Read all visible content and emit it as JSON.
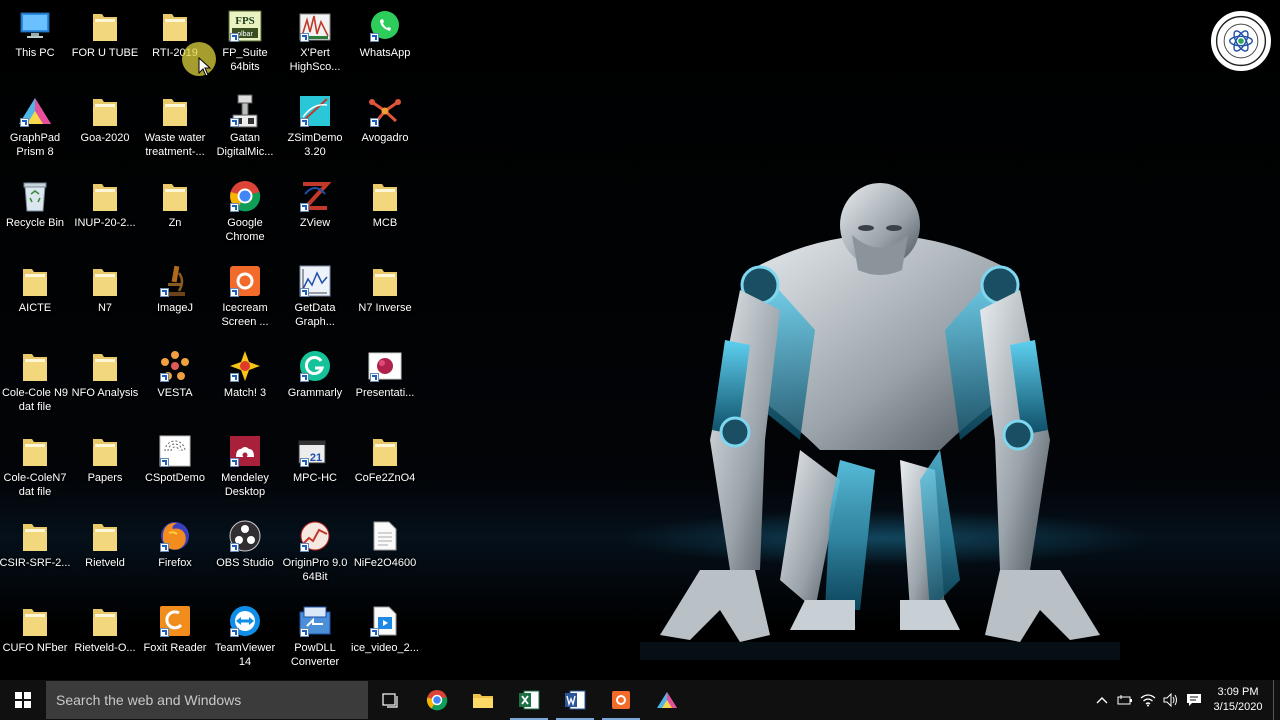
{
  "desktop": {
    "icons": [
      {
        "label": "This PC",
        "icon": "computer-icon"
      },
      {
        "label": "FOR U TUBE",
        "icon": "folder-icon"
      },
      {
        "label": "RTI-2019",
        "icon": "folder-icon"
      },
      {
        "label": "FP_Suite 64bits",
        "icon": "fullprof-icon"
      },
      {
        "label": "X'Pert HighSco...",
        "icon": "xpert-icon"
      },
      {
        "label": "WhatsApp",
        "icon": "whatsapp-icon"
      },
      {
        "label": "GraphPad Prism 8",
        "icon": "prism-icon"
      },
      {
        "label": "Goa-2020",
        "icon": "folder-icon"
      },
      {
        "label": "Waste water treatment-...",
        "icon": "folder-icon"
      },
      {
        "label": "Gatan DigitalMic...",
        "icon": "gatan-icon"
      },
      {
        "label": "ZSimDemo 3.20",
        "icon": "zsim-icon"
      },
      {
        "label": "Avogadro",
        "icon": "avogadro-icon"
      },
      {
        "label": "Recycle Bin",
        "icon": "recycle-bin-icon"
      },
      {
        "label": "INUP-20-2...",
        "icon": "folder-icon"
      },
      {
        "label": "Zn",
        "icon": "folder-icon"
      },
      {
        "label": "Google Chrome",
        "icon": "chrome-icon"
      },
      {
        "label": "ZView",
        "icon": "zview-icon"
      },
      {
        "label": "MCB",
        "icon": "folder-icon"
      },
      {
        "label": "AICTE",
        "icon": "folder-icon"
      },
      {
        "label": "N7",
        "icon": "folder-icon"
      },
      {
        "label": "ImageJ",
        "icon": "microscope-icon"
      },
      {
        "label": "Icecream Screen ...",
        "icon": "icecream-icon"
      },
      {
        "label": "GetData Graph...",
        "icon": "getdata-icon"
      },
      {
        "label": "N7 Inverse",
        "icon": "folder-icon"
      },
      {
        "label": "Cole-Cole N9 dat file",
        "icon": "folder-icon"
      },
      {
        "label": "NFO Analysis",
        "icon": "folder-icon"
      },
      {
        "label": "VESTA",
        "icon": "vesta-icon"
      },
      {
        "label": "Match! 3",
        "icon": "match-icon"
      },
      {
        "label": "Grammarly",
        "icon": "grammarly-icon"
      },
      {
        "label": "Presentati...",
        "icon": "presentation-icon"
      },
      {
        "label": "Cole-ColeN7 dat file",
        "icon": "folder-icon"
      },
      {
        "label": "Papers",
        "icon": "folder-icon"
      },
      {
        "label": "CSpotDemo",
        "icon": "cspot-icon"
      },
      {
        "label": "Mendeley Desktop",
        "icon": "mendeley-icon"
      },
      {
        "label": "MPC-HC",
        "icon": "mpc-icon"
      },
      {
        "label": "CoFe2ZnO4",
        "icon": "folder-icon"
      },
      {
        "label": "CSIR-SRF-2...",
        "icon": "folder-icon"
      },
      {
        "label": "Rietveld",
        "icon": "folder-icon"
      },
      {
        "label": "Firefox",
        "icon": "firefox-icon"
      },
      {
        "label": "OBS Studio",
        "icon": "obs-icon"
      },
      {
        "label": "OriginPro 9.0 64Bit",
        "icon": "origin-icon"
      },
      {
        "label": "NiFe2O4600",
        "icon": "file-icon"
      },
      {
        "label": "CUFO NFber",
        "icon": "folder-icon"
      },
      {
        "label": "Rietveld-O...",
        "icon": "folder-icon"
      },
      {
        "label": "Foxit Reader",
        "icon": "foxit-icon"
      },
      {
        "label": "TeamViewer 14",
        "icon": "teamviewer-icon"
      },
      {
        "label": "PowDLL Converter",
        "icon": "powdll-icon"
      },
      {
        "label": "ice_video_2...",
        "icon": "video-file-icon"
      }
    ]
  },
  "taskbar": {
    "search_placeholder": "Search the web and Windows",
    "pinned": [
      "task-view",
      "chrome",
      "file-explorer",
      "excel",
      "word",
      "icecream-recorder",
      "graphpad-prism"
    ],
    "active_app": "excel",
    "clock": {
      "time": "3:09 PM",
      "date": "3/15/2020"
    }
  },
  "colors": {
    "taskbar": "#101010",
    "search_box": "#3b3b3b",
    "robot_accent": "#2aa6d6"
  }
}
